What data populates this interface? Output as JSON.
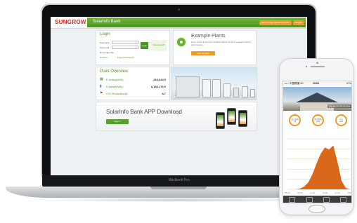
{
  "laptop": {
    "model_label": "MacBook Pro"
  },
  "site": {
    "logo": "SUNGROW",
    "title": "SolarInfo Bank",
    "top_nav": "Home | User Manual | Contact",
    "lang": "English",
    "login": {
      "heading": "Login",
      "username_label": "Username",
      "password_label": "Password",
      "button": "Login",
      "remember": "Remember Me",
      "register": "Register",
      "forgot": "Forgot password?",
      "qr_label": "Download APP"
    },
    "example": {
      "heading": "Example Plants",
      "description": "Have a look at how the SolarInfo Bank monitors example plants' performance.",
      "button": "Click to View"
    },
    "overview": {
      "heading": "Plant Overview",
      "rows": [
        {
          "label": "E-today(kWh):",
          "value": "283,944.5",
          "icon": "solar-panel-icon"
        },
        {
          "label": "E-total(MWh):",
          "value": "8,185,175.9",
          "icon": "energy-icon"
        },
        {
          "label": "CO₂ Reduction(t):",
          "value": "8.7",
          "icon": "co2-icon"
        }
      ]
    },
    "app_banner": {
      "heading": "SolarInfo Bank APP Download",
      "button": "View>>"
    }
  },
  "phone": {
    "carrier": "•••◦◦ 中国联通 4G",
    "time": "15:03",
    "battery": "47%",
    "plant_name": "PLANTLEC4104",
    "stats": [
      {
        "label": "当日发电",
        "value": "8.6"
      },
      {
        "label": "累计发电",
        "value": "1083"
      },
      {
        "label": "CO₂",
        "value": "1083"
      }
    ],
    "chart_data": {
      "type": "area",
      "x": [
        "05:00",
        "06:00",
        "07:00",
        "08:00",
        "09:00",
        "10:00",
        "11:00",
        "12:00",
        "13:00",
        "14:00",
        "15:00",
        "16:00",
        "17:00",
        "18:00",
        "19:00",
        "20:00"
      ],
      "values": [
        0,
        0,
        0,
        1,
        4,
        10,
        22,
        38,
        52,
        61,
        58,
        64,
        40,
        12,
        2,
        0
      ],
      "color": "#d9681a"
    }
  }
}
